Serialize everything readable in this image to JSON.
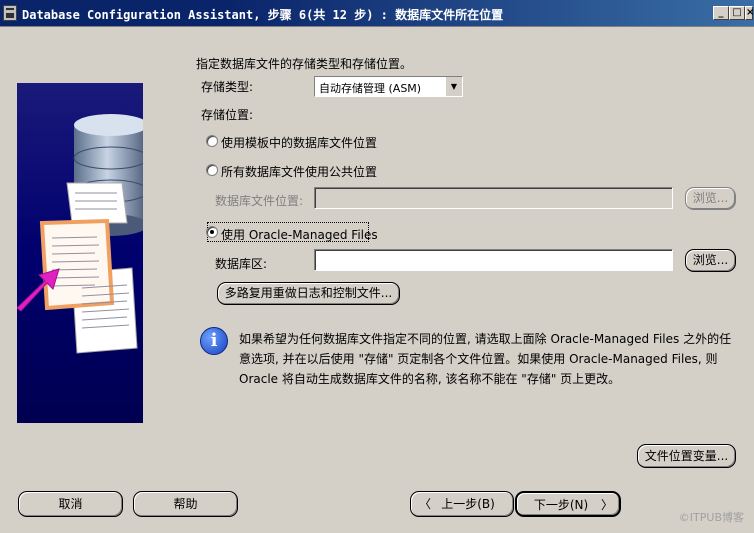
{
  "window": {
    "title": "Database Configuration Assistant, 步骤 6(共 12 步) : 数据库文件所在位置",
    "minimize": "_",
    "maximize": "□",
    "close": "×"
  },
  "main": {
    "intro": "指定数据库文件的存储类型和存储位置。",
    "storage_type_label": "存储类型:",
    "storage_type_value": "自动存储管理 (ASM)",
    "storage_location_label": "存储位置:",
    "options": [
      {
        "label": "使用模板中的数据库文件位置",
        "checked": false
      },
      {
        "label": "所有数据库文件使用公共位置",
        "checked": false
      },
      {
        "label": "使用 Oracle-Managed Files",
        "checked": true
      }
    ],
    "db_file_location_label": "数据库文件位置:",
    "db_file_location_value": "",
    "browse_label": "浏览...",
    "db_area_label": "数据库区:",
    "db_area_value": "",
    "multiplex_button": "多路复用重做日志和控制文件...",
    "info_text": "如果希望为任何数据库文件指定不同的位置, 请选取上面除 Oracle-Managed Files 之外的任意选项, 并在以后使用 \"存储\" 页定制各个文件位置。如果使用 Oracle-Managed Files, 则 Oracle 将自动生成数据库文件的名称, 该名称不能在 \"存储\" 页上更改。",
    "file_location_vars_button": "文件位置变量..."
  },
  "footer": {
    "cancel": "取消",
    "help": "帮助",
    "back": "上一步(B)",
    "next": "下一步(N)",
    "back_arrow": "〈",
    "next_arrow": "〉"
  },
  "watermark": "©ITPUB博客",
  "colors": {
    "titlebar": "#0a246a",
    "dialog_bg": "#d4d0c8",
    "image_bg": "#00006e",
    "arrow": "#e020c0"
  }
}
